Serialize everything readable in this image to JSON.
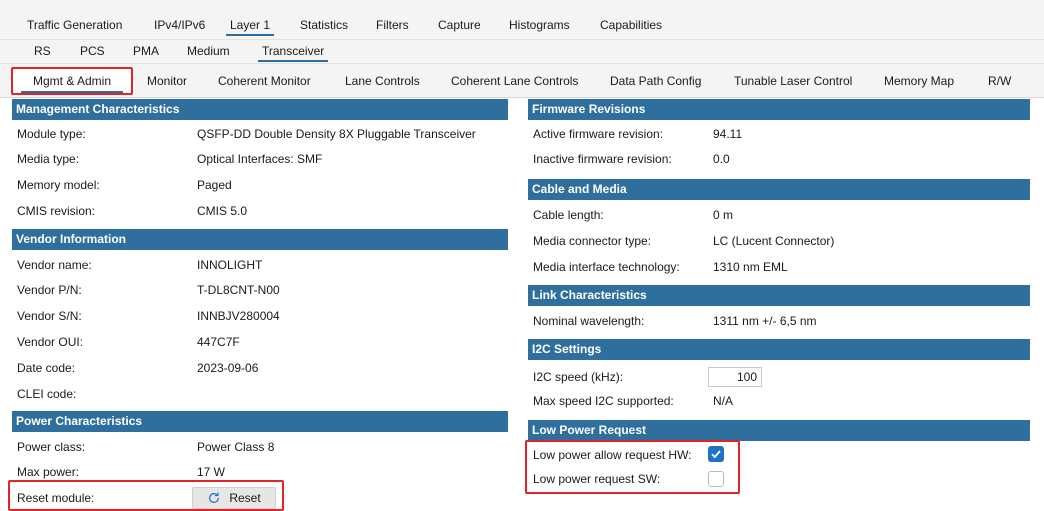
{
  "tabs_level1": [
    "Traffic Generation",
    "IPv4/IPv6",
    "Layer 1",
    "Statistics",
    "Filters",
    "Capture",
    "Histograms",
    "Capabilities"
  ],
  "tabs_level2": [
    "RS",
    "PCS",
    "PMA",
    "Medium",
    "Transceiver"
  ],
  "tabs_level3": [
    "Mgmt & Admin",
    "Monitor",
    "Coherent Monitor",
    "Lane Controls",
    "Coherent Lane Controls",
    "Data Path Config",
    "Tunable Laser Control",
    "Memory Map",
    "R/W"
  ],
  "management": {
    "title": "Management Characteristics",
    "rows": [
      {
        "label": "Module type:",
        "value": "QSFP-DD Double Density 8X Pluggable Transceiver"
      },
      {
        "label": "Media type:",
        "value": "Optical Interfaces: SMF"
      },
      {
        "label": "Memory model:",
        "value": "Paged"
      },
      {
        "label": "CMIS revision:",
        "value": "CMIS 5.0"
      }
    ]
  },
  "vendor": {
    "title": "Vendor Information",
    "rows": [
      {
        "label": "Vendor name:",
        "value": "INNOLIGHT"
      },
      {
        "label": "Vendor P/N:",
        "value": "T-DL8CNT-N00"
      },
      {
        "label": "Vendor S/N:",
        "value": "INNBJV280004"
      },
      {
        "label": "Vendor OUI:",
        "value": "447C7F"
      },
      {
        "label": "Date code:",
        "value": "2023-09-06"
      },
      {
        "label": "CLEI code:",
        "value": ""
      }
    ]
  },
  "power": {
    "title": "Power Characteristics",
    "rows": [
      {
        "label": "Power class:",
        "value": "Power Class 8"
      },
      {
        "label": "Max power:",
        "value": "17 W"
      }
    ],
    "reset_label": "Reset module:",
    "reset_button": "Reset"
  },
  "firmware": {
    "title": "Firmware Revisions",
    "rows": [
      {
        "label": "Active firmware revision:",
        "value": "94.11"
      },
      {
        "label": "Inactive firmware revision:",
        "value": "0.0"
      }
    ]
  },
  "cable": {
    "title": "Cable and Media",
    "rows": [
      {
        "label": "Cable length:",
        "value": "0 m"
      },
      {
        "label": "Media connector type:",
        "value": "LC (Lucent Connector)"
      },
      {
        "label": "Media interface technology:",
        "value": "1310 nm EML"
      }
    ]
  },
  "link": {
    "title": "Link Characteristics",
    "rows": [
      {
        "label": "Nominal wavelength:",
        "value": "1311 nm +/- 6,5 nm"
      }
    ]
  },
  "i2c": {
    "title": "I2C Settings",
    "speed_label": "I2C speed (kHz):",
    "speed_value": "100",
    "max_label": "Max speed I2C supported:",
    "max_value": "N/A"
  },
  "low_power": {
    "title": "Low Power Request",
    "hw_label": "Low power allow request HW:",
    "hw_checked": true,
    "sw_label": "Low power request SW:",
    "sw_checked": false
  }
}
